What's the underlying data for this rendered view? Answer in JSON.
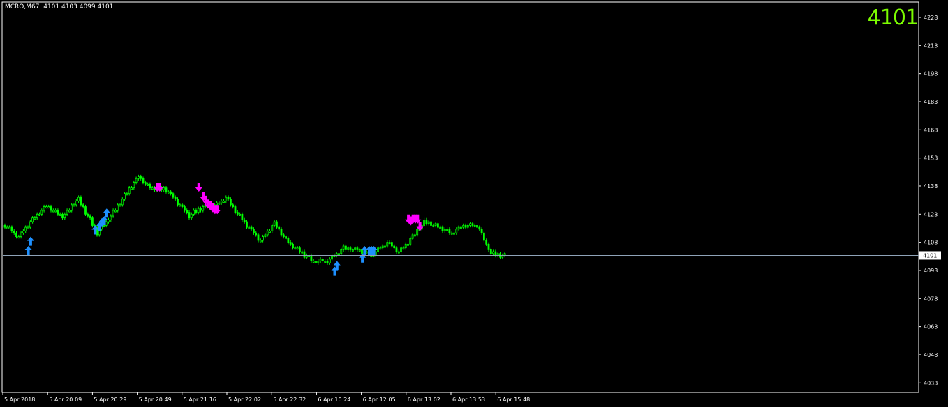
{
  "header": {
    "symbol": "MCRO,M67",
    "ohlc": "4101 4103 4099 4101"
  },
  "big_price": "4101",
  "colors": {
    "background": "#000000",
    "frame": "#ffffff",
    "candle": "#00ff00",
    "price_line": "#8fa3b7",
    "up_arrow": "#1e90ff",
    "down_arrow": "#ff00ff",
    "big_price": "#7cfc00"
  },
  "chart_data": {
    "type": "candlestick",
    "ylim": [
      4026,
      4236
    ],
    "y_ticks": [
      "4228",
      "4213",
      "4198",
      "4183",
      "4168",
      "4153",
      "4138",
      "4123",
      "4108",
      "4093",
      "4078",
      "4063",
      "4048",
      "4033"
    ],
    "x_ticks": [
      "5 Apr 2018",
      "5 Apr 20:09",
      "5 Apr 20:29",
      "5 Apr 20:49",
      "5 Apr 21:16",
      "5 Apr 22:02",
      "5 Apr 22:32",
      "6 Apr 10:24",
      "6 Apr 12:05",
      "6 Apr 13:02",
      "6 Apr 13:53",
      "6 Apr 15:48"
    ],
    "current_price": "4101",
    "bar_count": 181,
    "close_waypoints": [
      [
        0,
        4117
      ],
      [
        6,
        4111
      ],
      [
        12,
        4120
      ],
      [
        18,
        4127
      ],
      [
        25,
        4122
      ],
      [
        32,
        4131
      ],
      [
        40,
        4113
      ],
      [
        46,
        4122
      ],
      [
        52,
        4133
      ],
      [
        58,
        4143
      ],
      [
        63,
        4137
      ],
      [
        70,
        4136
      ],
      [
        76,
        4128
      ],
      [
        80,
        4122
      ],
      [
        86,
        4127
      ],
      [
        92,
        4128
      ],
      [
        96,
        4132
      ],
      [
        103,
        4120
      ],
      [
        111,
        4109
      ],
      [
        117,
        4118
      ],
      [
        122,
        4109
      ],
      [
        128,
        4103
      ],
      [
        134,
        4098
      ],
      [
        140,
        4098
      ],
      [
        147,
        4105
      ],
      [
        153,
        4104
      ],
      [
        159,
        4101
      ],
      [
        166,
        4108
      ],
      [
        171,
        4103
      ],
      [
        177,
        4111
      ],
      [
        182,
        4119
      ],
      [
        187,
        4117
      ],
      [
        194,
        4113
      ],
      [
        199,
        4117
      ],
      [
        205,
        4117
      ],
      [
        211,
        4102
      ],
      [
        217,
        4101
      ]
    ],
    "up_signals": [
      {
        "x_index": 12,
        "price": 4106
      },
      {
        "x_index": 13,
        "price": 4111
      },
      {
        "x_index": 41,
        "price": 4117
      },
      {
        "x_index": 43,
        "price": 4119
      },
      {
        "x_index": 44,
        "price": 4121
      },
      {
        "x_index": 45,
        "price": 4122
      },
      {
        "x_index": 46,
        "price": 4126
      },
      {
        "x_index": 145,
        "price": 4095
      },
      {
        "x_index": 146,
        "price": 4098
      },
      {
        "x_index": 157,
        "price": 4102
      },
      {
        "x_index": 158,
        "price": 4106
      },
      {
        "x_index": 160,
        "price": 4106
      },
      {
        "x_index": 161,
        "price": 4106
      },
      {
        "x_index": 162,
        "price": 4106
      }
    ],
    "down_signals": [
      {
        "x_index": 68,
        "price": 4135
      },
      {
        "x_index": 69,
        "price": 4135
      },
      {
        "x_index": 86,
        "price": 4135
      },
      {
        "x_index": 88,
        "price": 4130
      },
      {
        "x_index": 89,
        "price": 4128
      },
      {
        "x_index": 90,
        "price": 4126
      },
      {
        "x_index": 91,
        "price": 4125
      },
      {
        "x_index": 92,
        "price": 4124
      },
      {
        "x_index": 93,
        "price": 4123
      },
      {
        "x_index": 94,
        "price": 4123
      },
      {
        "x_index": 177,
        "price": 4118
      },
      {
        "x_index": 178,
        "price": 4117
      },
      {
        "x_index": 179,
        "price": 4118
      },
      {
        "x_index": 180,
        "price": 4118
      },
      {
        "x_index": 181,
        "price": 4118
      },
      {
        "x_index": 182,
        "price": 4114
      }
    ]
  }
}
